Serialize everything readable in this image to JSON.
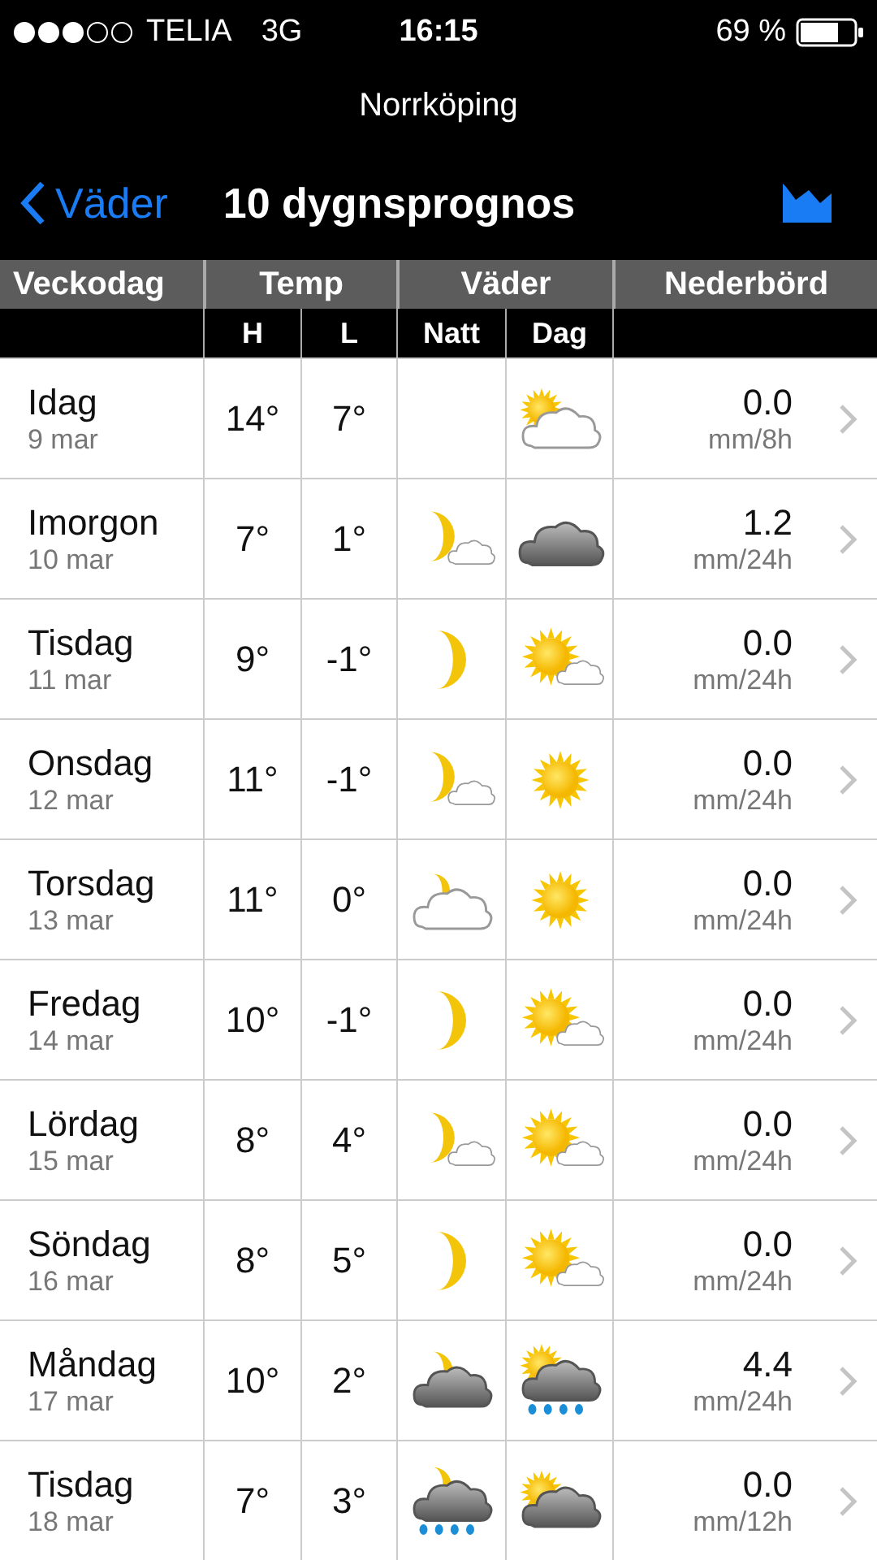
{
  "status_bar": {
    "carrier": "TELIA",
    "network": "3G",
    "time": "16:15",
    "battery": "69 %"
  },
  "location": "Norrköping",
  "nav": {
    "back": "Väder",
    "title": "10 dygnsprognos"
  },
  "table": {
    "columns": [
      "Veckodag",
      "Temp",
      "Väder",
      "Nederbörd"
    ],
    "subcolumns": [
      "H",
      "L",
      "Natt",
      "Dag"
    ],
    "rows": [
      {
        "day": "Idag",
        "date": "9 mar",
        "high": "14°",
        "low": "7°",
        "day_icon": {
          "kind": "cloudy-bright"
        },
        "precip": "0.0",
        "unit": "mm/8h"
      },
      {
        "day": "Imorgon",
        "date": "10 mar",
        "high": "7°",
        "low": "1°",
        "night_icon": {
          "kind": "few-clouds"
        },
        "day_icon": {
          "kind": "overcast"
        },
        "precip": "1.2",
        "unit": "mm/24h"
      },
      {
        "day": "Tisdag",
        "date": "11 mar",
        "high": "9°",
        "low": "-1°",
        "night_icon": {
          "kind": "clear"
        },
        "day_icon": {
          "kind": "few-clouds"
        },
        "precip": "0.0",
        "unit": "mm/24h"
      },
      {
        "day": "Onsdag",
        "date": "12 mar",
        "high": "11°",
        "low": "-1°",
        "night_icon": {
          "kind": "few-clouds"
        },
        "day_icon": {
          "kind": "clear"
        },
        "precip": "0.0",
        "unit": "mm/24h"
      },
      {
        "day": "Torsdag",
        "date": "13 mar",
        "high": "11°",
        "low": "0°",
        "night_icon": {
          "kind": "cloudy-bright"
        },
        "day_icon": {
          "kind": "clear"
        },
        "precip": "0.0",
        "unit": "mm/24h"
      },
      {
        "day": "Fredag",
        "date": "14 mar",
        "high": "10°",
        "low": "-1°",
        "night_icon": {
          "kind": "clear"
        },
        "day_icon": {
          "kind": "few-clouds"
        },
        "precip": "0.0",
        "unit": "mm/24h"
      },
      {
        "day": "Lördag",
        "date": "15 mar",
        "high": "8°",
        "low": "4°",
        "night_icon": {
          "kind": "few-clouds"
        },
        "day_icon": {
          "kind": "few-clouds"
        },
        "precip": "0.0",
        "unit": "mm/24h"
      },
      {
        "day": "Söndag",
        "date": "16 mar",
        "high": "8°",
        "low": "5°",
        "night_icon": {
          "kind": "clear"
        },
        "day_icon": {
          "kind": "few-clouds"
        },
        "precip": "0.0",
        "unit": "mm/24h"
      },
      {
        "day": "Måndag",
        "date": "17 mar",
        "high": "10°",
        "low": "2°",
        "night_icon": {
          "kind": "dark-cloud"
        },
        "day_icon": {
          "kind": "rain"
        },
        "precip": "4.4",
        "unit": "mm/24h"
      },
      {
        "day": "Tisdag",
        "date": "18 mar",
        "high": "7°",
        "low": "3°",
        "night_icon": {
          "kind": "rain"
        },
        "day_icon": {
          "kind": "dark-cloud"
        },
        "precip": "0.0",
        "unit": "mm/12h"
      }
    ]
  }
}
